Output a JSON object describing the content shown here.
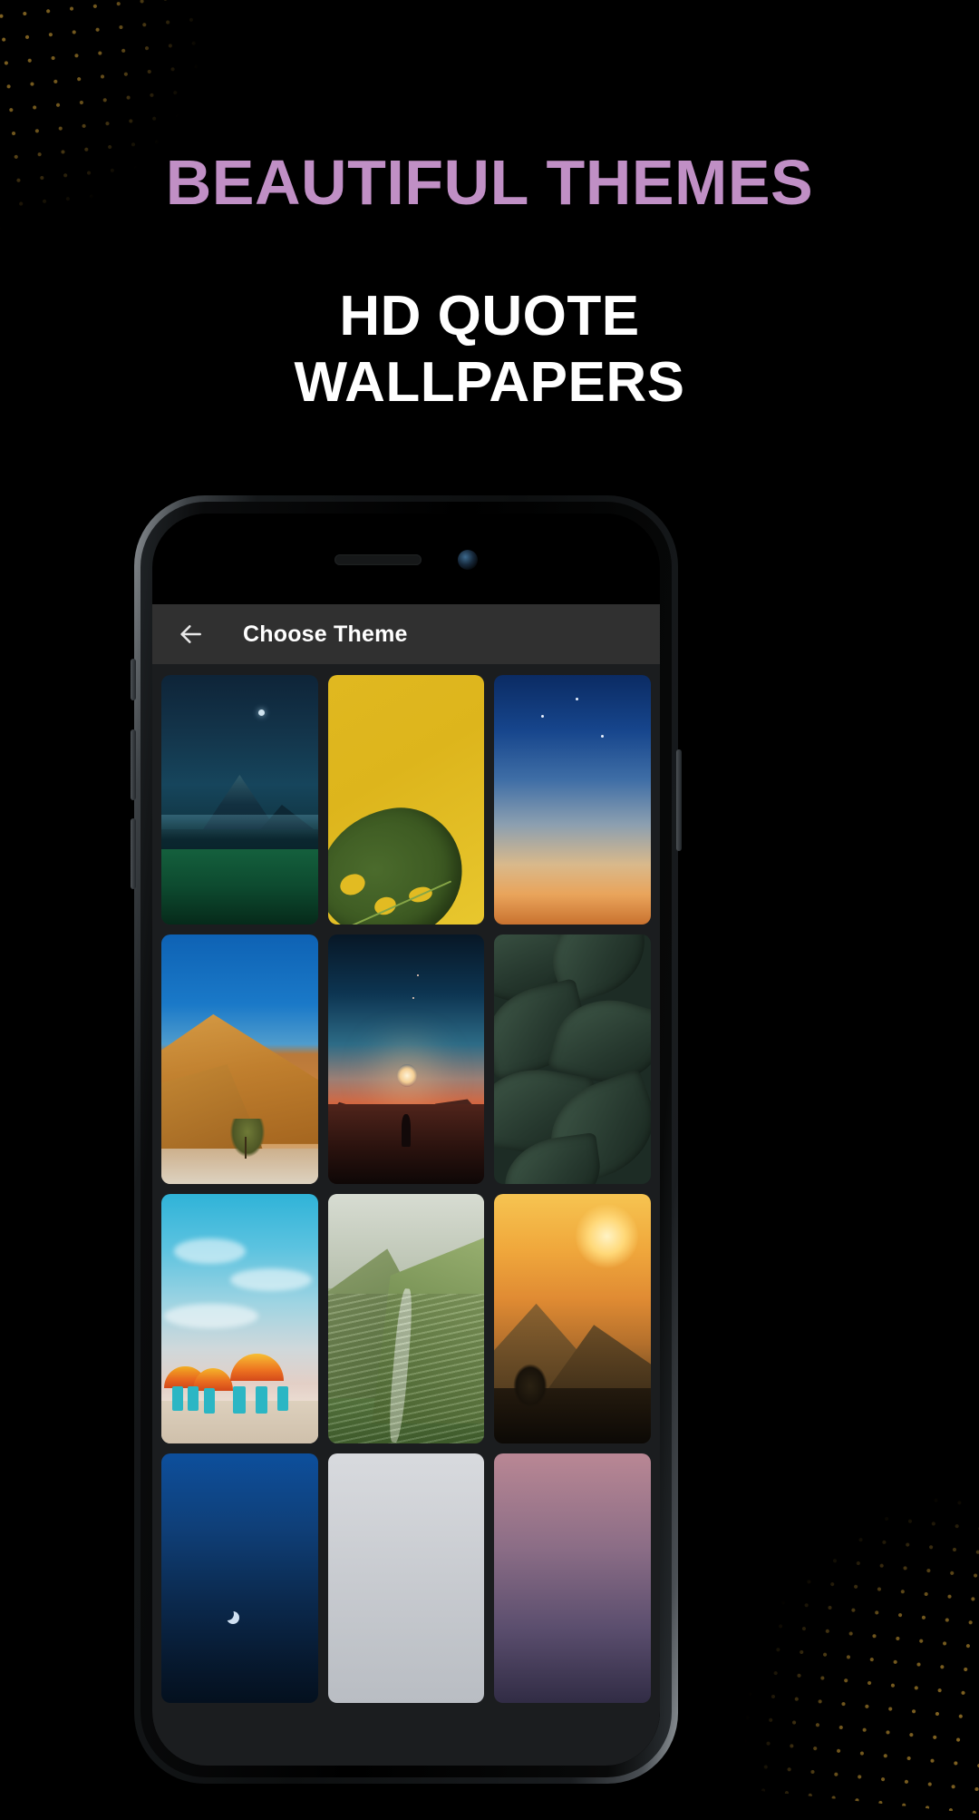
{
  "promo": {
    "headline": "BEAUTIFUL THEMES",
    "subheading_line1": "HD QUOTE",
    "subheading_line2": "WALLPAPERS",
    "headline_color": "#c08fc5",
    "subheading_color": "#ffffff",
    "background_color": "#000000",
    "dot_pattern_color": "#8a6a24"
  },
  "phone": {
    "frame_color": "#15181a",
    "speaker_label": "earpiece-speaker",
    "camera_label": "front-camera"
  },
  "app": {
    "appbar": {
      "title": "Choose Theme",
      "back_icon": "arrow-left-icon",
      "background_color": "#303030",
      "title_color": "#ffffff"
    },
    "grid": {
      "background_color": "#1b1d1f",
      "columns": 3,
      "themes": [
        {
          "id": 1,
          "name": "night-mountain-grass",
          "accent": "#16455c"
        },
        {
          "id": 2,
          "name": "yellow-monstera-leaf",
          "accent": "#e0b820"
        },
        {
          "id": 3,
          "name": "blue-sky-warm-horizon",
          "accent": "#16458c"
        },
        {
          "id": 4,
          "name": "desert-dune-tree",
          "accent": "#c8813a"
        },
        {
          "id": 5,
          "name": "sunset-silhouette",
          "accent": "#d4663f"
        },
        {
          "id": 6,
          "name": "dark-green-leaves",
          "accent": "#26382e"
        },
        {
          "id": 7,
          "name": "beach-umbrellas",
          "accent": "#ed7320"
        },
        {
          "id": 8,
          "name": "terraced-green-hills",
          "accent": "#7c9660"
        },
        {
          "id": 9,
          "name": "golden-sunrise-hills",
          "accent": "#f0a83c"
        },
        {
          "id": 10,
          "name": "blue-night-moon",
          "accent": "#0f3f78"
        },
        {
          "id": 11,
          "name": "light-grey-minimal",
          "accent": "#c8cbd0"
        },
        {
          "id": 12,
          "name": "pink-purple-gradient",
          "accent": "#8b6d86"
        }
      ]
    }
  }
}
